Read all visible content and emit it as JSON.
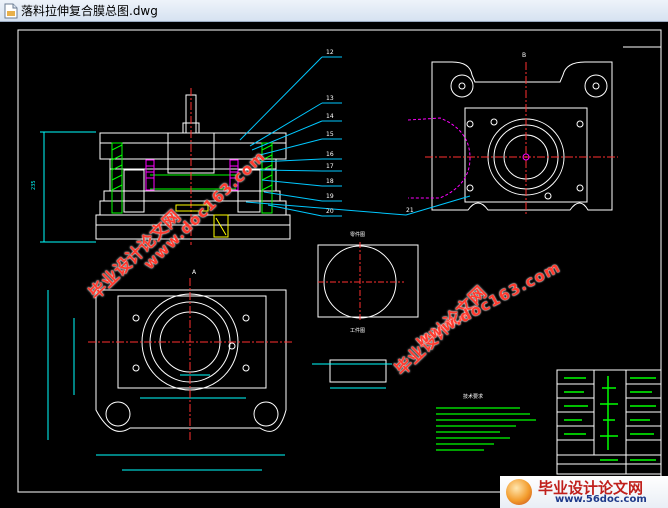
{
  "window": {
    "title": "落料拉伸复合膜总图.dwg",
    "icon": "dwg-file-icon"
  },
  "drawing": {
    "part_numbers": [
      "12",
      "13",
      "14",
      "15",
      "16",
      "17",
      "18",
      "19",
      "20",
      "21"
    ],
    "view_label_b": "B",
    "view_label_a": "A",
    "part_label": "零件图",
    "part_label_2": "工件图",
    "notes_title": "技术要求"
  },
  "watermark": {
    "text_cn": "毕业设计论文网",
    "text_url": "www.doc163.com"
  },
  "logo": {
    "text_cn": "毕业设计论文网",
    "text_url": "www.56doc.com"
  },
  "colors": {
    "background": "#000000",
    "frame": "#ffffff",
    "leader": "#00c8ff",
    "dimension": "#00ffff",
    "centerline": "#ff3030",
    "magenta": "#ff00ff",
    "green": "#00ff00",
    "yellow": "#ffff00",
    "watermark": "#ff3b2f"
  }
}
